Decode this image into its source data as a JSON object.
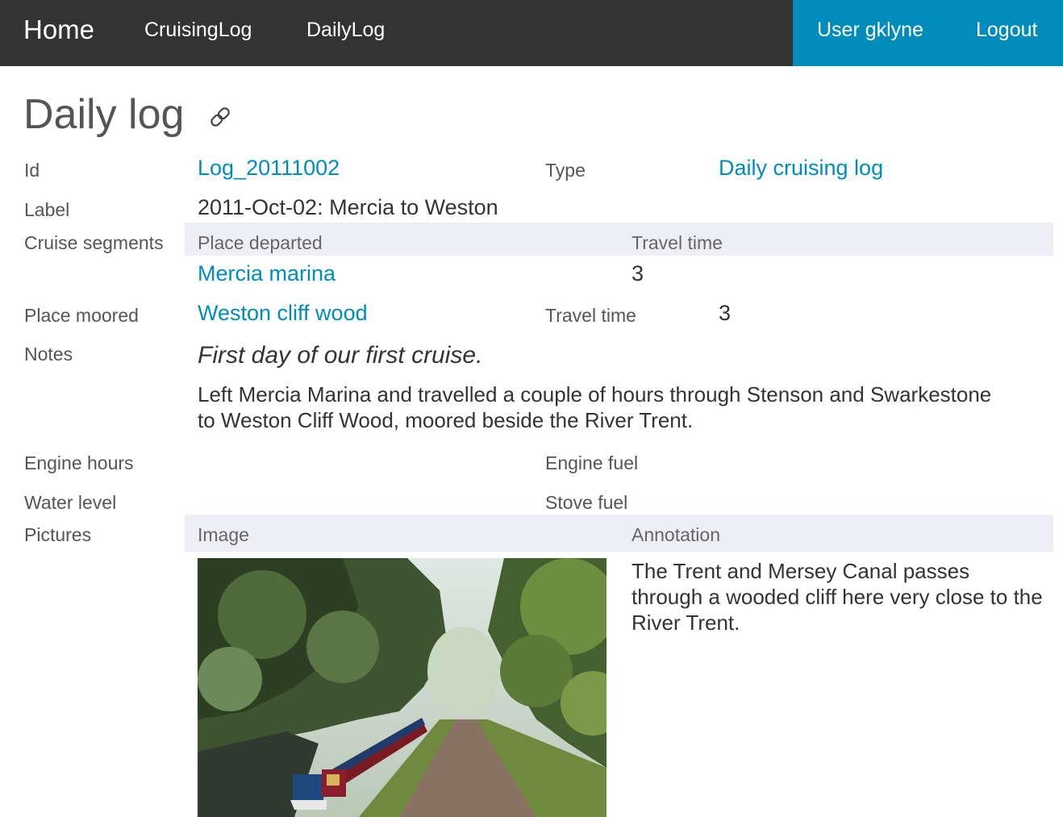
{
  "nav": {
    "home": "Home",
    "cruising_log": "CruisingLog",
    "daily_log": "DailyLog",
    "user": "User gklyne",
    "logout": "Logout",
    "user_area_color": "#008cba"
  },
  "page": {
    "title": "Daily log",
    "title_icon": "link-icon"
  },
  "fields": {
    "id_label": "Id",
    "id_value": "Log_20111002",
    "type_label": "Type",
    "type_value": "Daily cruising log",
    "label_label": "Label",
    "label_value": "2011-Oct-02: Mercia to Weston",
    "segments_label": "Cruise segments",
    "segments_head_place": "Place departed",
    "segments_head_time": "Travel time",
    "segments": [
      {
        "place": "Mercia marina",
        "time": "3"
      }
    ],
    "moored_label": "Place moored",
    "moored_value": "Weston cliff wood",
    "moored_time_label": "Travel time",
    "moored_time_value": "3",
    "notes_label": "Notes",
    "notes_italic": "First day of our first cruise.",
    "notes_body": "Left Mercia Marina and travelled a couple of hours through Stenson and Swarkestone to Weston Cliff Wood, moored beside the River Trent.",
    "engine_hours_label": "Engine hours",
    "engine_fuel_label": "Engine fuel",
    "water_level_label": "Water level",
    "stove_fuel_label": "Stove fuel",
    "pictures_label": "Pictures",
    "pictures_head_image": "Image",
    "pictures_head_annotation": "Annotation",
    "pictures": [
      {
        "annotation": "The Trent and Mersey Canal passes through a wooded cliff here very close to the River Trent."
      }
    ]
  },
  "colors": {
    "topbar": "#333333",
    "link": "#008cba",
    "band": "#eeeef6"
  }
}
